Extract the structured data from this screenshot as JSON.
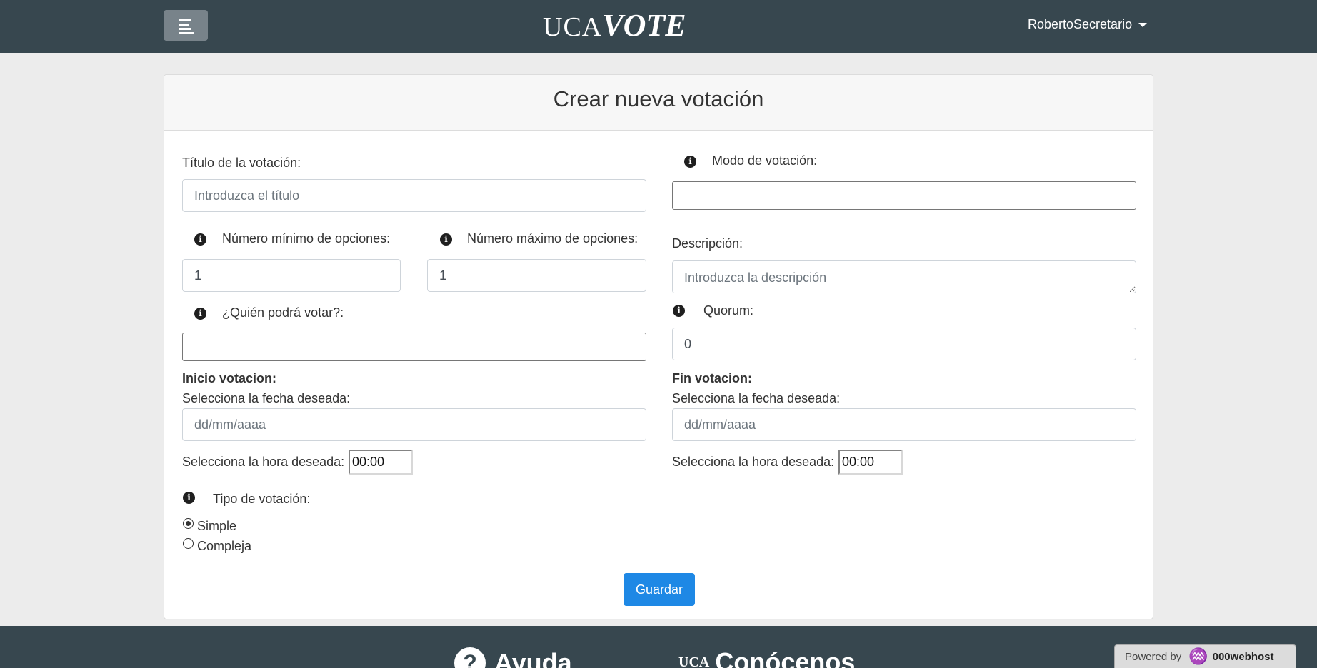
{
  "header": {
    "logo_uca": "UCA",
    "logo_vote": "VOTE",
    "user_name": "RobertoSecretario"
  },
  "form": {
    "title": "Crear nueva votación",
    "titulo_label": "Título de la votación:",
    "titulo_placeholder": "Introduzca el título",
    "modo_label": "Modo de votación:",
    "modo_value": "",
    "min_label": "Número mínimo de opciones:",
    "min_value": "1",
    "max_label": "Número máximo de opciones:",
    "max_value": "1",
    "descripcion_label": "Descripción:",
    "descripcion_placeholder": "Introduzca la descripción",
    "quien_label": "¿Quién podrá votar?:",
    "quien_value": "",
    "quorum_label": "Quorum:",
    "quorum_value": "0",
    "inicio_heading": "Inicio votacion:",
    "fin_heading": "Fin votacion:",
    "fecha_label": "Selecciona la fecha deseada:",
    "fecha_placeholder": "dd/mm/aaaa",
    "hora_label": "Selecciona la hora deseada:",
    "hora_inicio": "00:00",
    "hora_fin": "00:00",
    "tipo_label": "Tipo de votación:",
    "tipo_options": [
      "Simple",
      "Compleja"
    ],
    "tipo_selected": "Simple",
    "save_label": "Guardar"
  },
  "footer": {
    "help_label": "Ayuda",
    "about_label": "Conócenos",
    "about_logo": "UCA",
    "powered_label": "Powered by",
    "powered_brand": "000webhost"
  },
  "colors": {
    "header_bg": "#37474f",
    "primary_button": "#1e88e5",
    "page_bg": "#ececec"
  }
}
